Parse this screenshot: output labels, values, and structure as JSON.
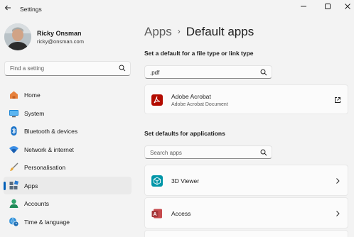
{
  "app": {
    "title": "Settings"
  },
  "profile": {
    "name": "Ricky Onsman",
    "email": "ricky@onsman.com"
  },
  "sidebar_search": {
    "placeholder": "Find a setting"
  },
  "nav": {
    "items": [
      {
        "label": "Home",
        "icon": "home-icon",
        "active": false
      },
      {
        "label": "System",
        "icon": "monitor-icon",
        "active": false
      },
      {
        "label": "Bluetooth & devices",
        "icon": "bluetooth-icon",
        "active": false
      },
      {
        "label": "Network & internet",
        "icon": "wifi-icon",
        "active": false
      },
      {
        "label": "Personalisation",
        "icon": "brush-icon",
        "active": false
      },
      {
        "label": "Apps",
        "icon": "apps-icon",
        "active": true
      },
      {
        "label": "Accounts",
        "icon": "person-icon",
        "active": false
      },
      {
        "label": "Time & language",
        "icon": "clock-globe-icon",
        "active": false
      }
    ]
  },
  "breadcrumb": {
    "parent": "Apps",
    "separator": "›",
    "current": "Default apps"
  },
  "file_type": {
    "heading": "Set a default for a file type or link type",
    "value": ".pdf",
    "result": {
      "title": "Adobe Acrobat",
      "subtitle": "Adobe Acrobat Document",
      "icon": "adobe-acrobat-icon"
    }
  },
  "apps_section": {
    "heading": "Set defaults for applications",
    "placeholder": "Search apps",
    "apps": [
      {
        "name": "3D Viewer",
        "icon": "3d-viewer-icon"
      },
      {
        "name": "Access",
        "icon": "access-icon"
      }
    ]
  },
  "colors": {
    "accent": "#005fb8",
    "acrobat": "#b30b00",
    "access": "#a4373a",
    "viewer3d": "#0096a8"
  }
}
